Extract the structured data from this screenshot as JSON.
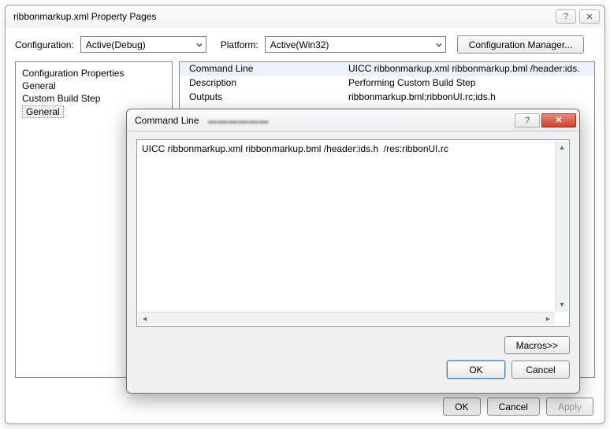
{
  "window": {
    "title": "ribbonmarkup.xml Property Pages",
    "help_label": "?",
    "close_label": "✕"
  },
  "config_row": {
    "config_label": "Configuration:",
    "config_value": "Active(Debug)",
    "platform_label": "Platform:",
    "platform_value": "Active(Win32)",
    "manager_button": "Configuration Manager..."
  },
  "tree": {
    "root": "Configuration Properties",
    "general": "General",
    "custom_step": "Custom Build Step",
    "custom_general": "General"
  },
  "grid": {
    "rows": [
      {
        "name": "Command Line",
        "value": "UICC ribbonmarkup.xml ribbonmarkup.bml /header:ids."
      },
      {
        "name": "Description",
        "value": "Performing Custom Build Step"
      },
      {
        "name": "Outputs",
        "value": "ribbonmarkup.bml;ribbonUI.rc;ids.h"
      }
    ]
  },
  "outer_buttons": {
    "ok": "OK",
    "cancel": "Cancel",
    "apply": "Apply"
  },
  "inner": {
    "title": "Command Line",
    "textarea_value": "UICC ribbonmarkup.xml ribbonmarkup.bml /header:ids.h  /res:ribbonUI.rc",
    "macros": "Macros>>",
    "ok": "OK",
    "cancel": "Cancel",
    "help_label": "?",
    "close_label": "✕"
  }
}
